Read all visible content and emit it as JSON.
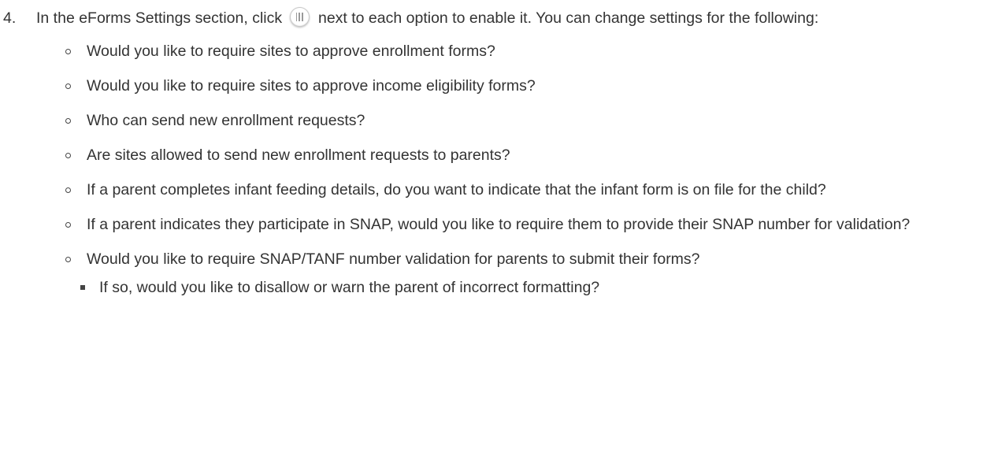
{
  "step": {
    "number": "4.",
    "text_before_icon": "In the eForms Settings section, click",
    "icon": "toggle-switch-icon",
    "text_after_icon": "next to each option to enable it. You can change settings for the following:"
  },
  "options": [
    "Would you like to require sites to approve enrollment forms?",
    "Would you like to require sites to approve income eligibility forms?",
    "Who can send new enrollment requests?",
    "Are sites allowed to send new enrollment requests to parents?",
    "If a parent completes infant feeding details, do you want to indicate that the infant form is on file for the child?",
    "If a parent indicates they participate in SNAP, would you like to require them to provide their SNAP number for validation?",
    "Would you like to require SNAP/TANF number validation for parents to submit their forms?"
  ],
  "suboptions": [
    "If so, would you like to disallow or warn the parent of incorrect formatting?"
  ]
}
